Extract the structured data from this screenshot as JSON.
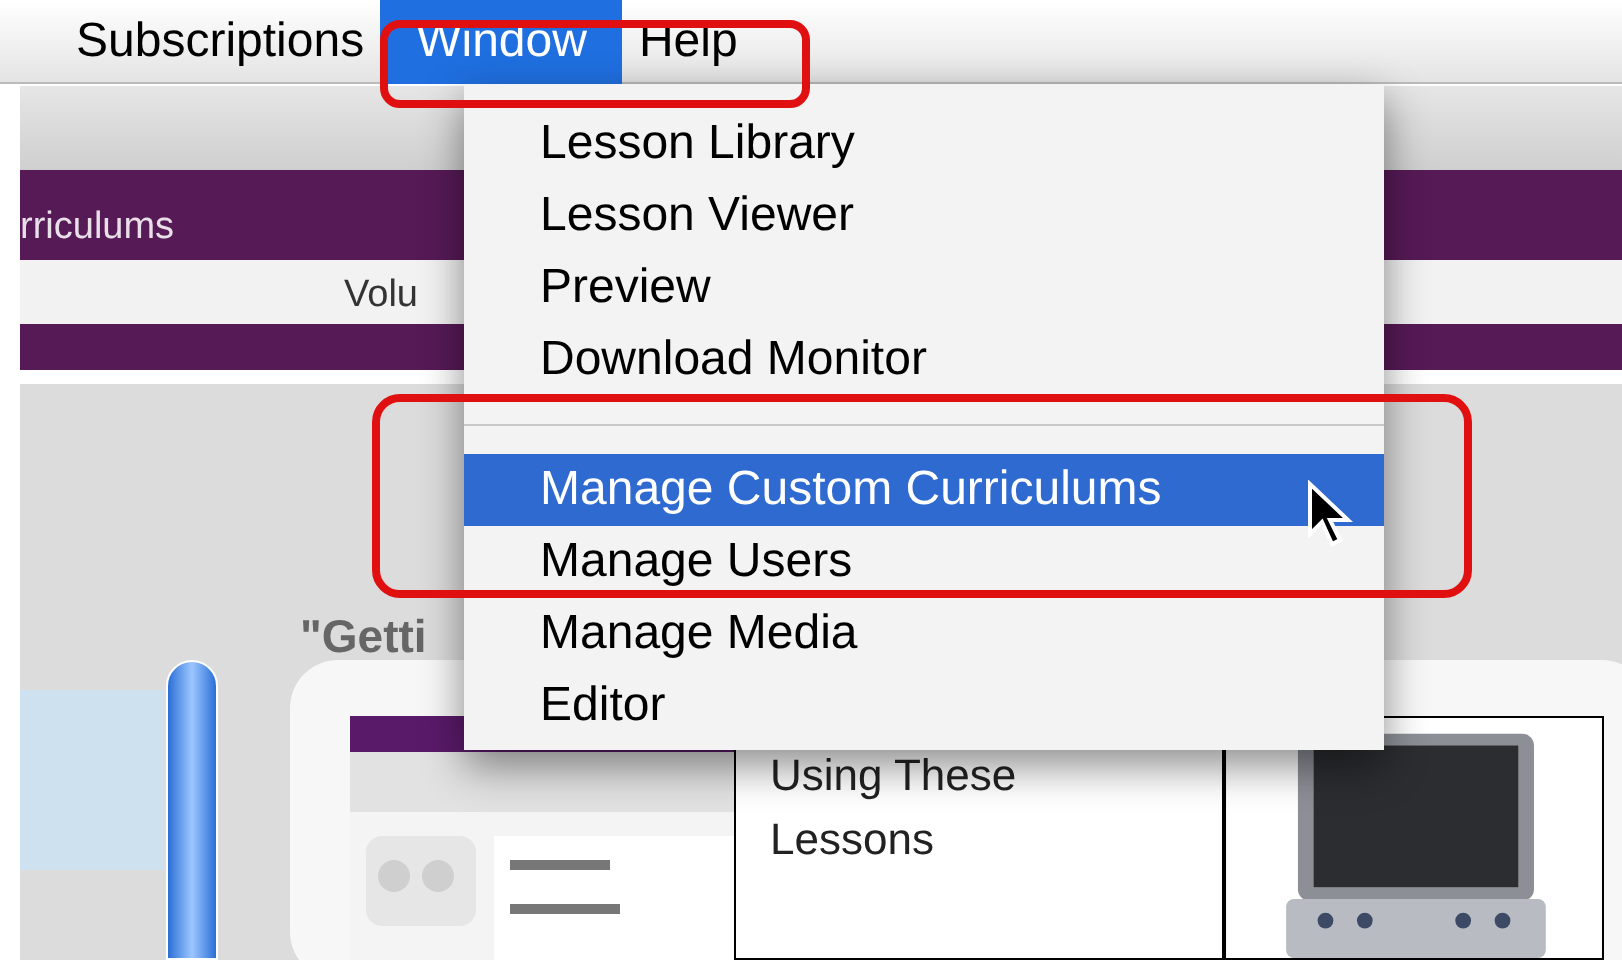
{
  "menu_bar": [
    {
      "label": "Subscriptions",
      "selected": false
    },
    {
      "label": "Window",
      "selected": true
    },
    {
      "label": "Help",
      "selected": false
    }
  ],
  "window_menu": {
    "items": [
      {
        "kind": "item",
        "label": "Lesson Library",
        "selected": false
      },
      {
        "kind": "item",
        "label": "Lesson Viewer",
        "selected": false
      },
      {
        "kind": "item",
        "label": "Preview",
        "selected": false
      },
      {
        "kind": "item",
        "label": "Download Monitor",
        "selected": false
      },
      {
        "kind": "separator"
      },
      {
        "kind": "item",
        "label": "Manage Custom Curriculums",
        "selected": true
      },
      {
        "kind": "item",
        "label": "Manage Users",
        "selected": false
      },
      {
        "kind": "item",
        "label": "Manage Media",
        "selected": false
      },
      {
        "kind": "item",
        "label": "Editor",
        "selected": false
      }
    ]
  },
  "header_band": {
    "title": "rriculums",
    "field_text": "Volu"
  },
  "section_title": "\"Getti",
  "lesson_card": {
    "title": "Using These Lessons"
  }
}
